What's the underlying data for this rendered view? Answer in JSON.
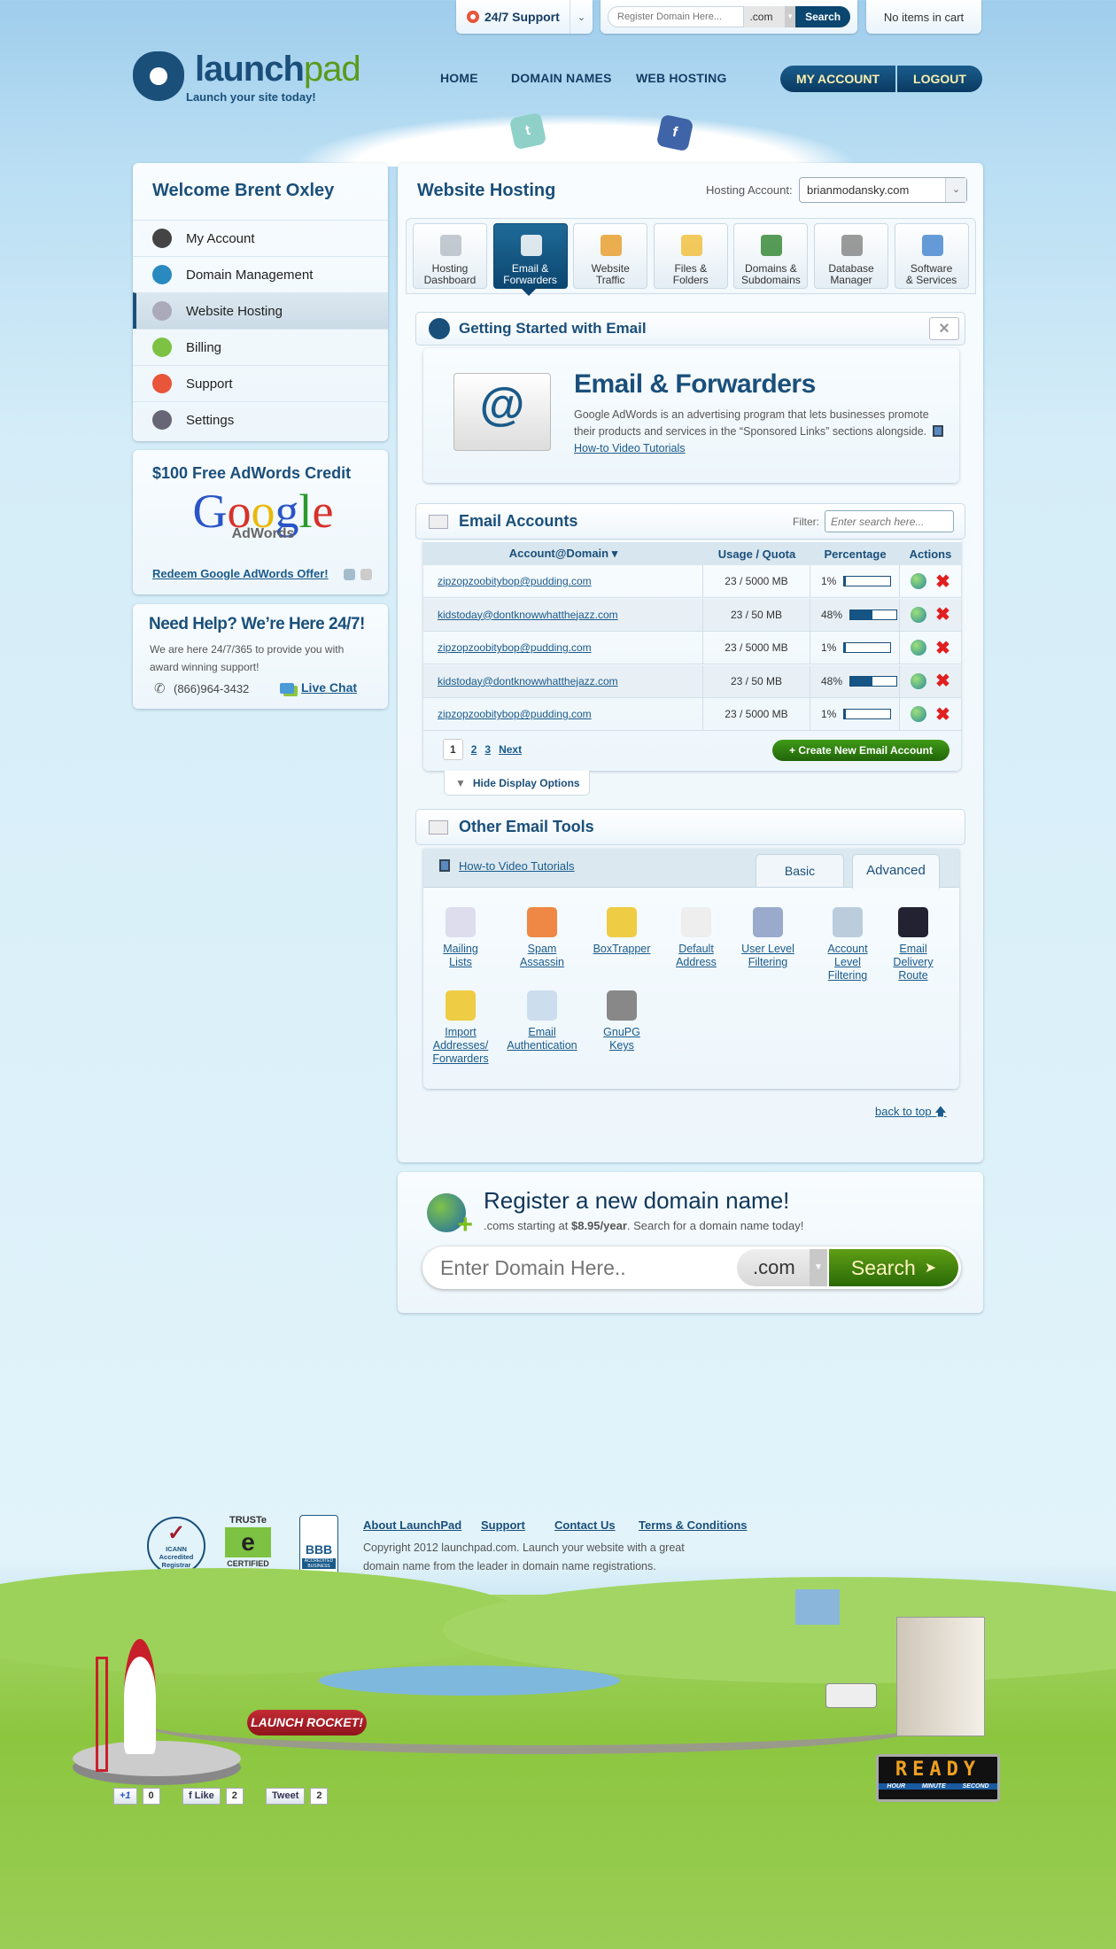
{
  "topbar": {
    "support_label": "24/7 Support",
    "domain_placeholder": "Register Domain Here...",
    "tld": ".com",
    "search_label": "Search",
    "cart_text": "No items in cart"
  },
  "brand": {
    "name_part1": "launch",
    "name_part2": "pad",
    "tagline": "Launch your site today!"
  },
  "nav": {
    "items": [
      "HOME",
      "DOMAIN NAMES",
      "WEB HOSTING"
    ],
    "my_account": "MY ACCOUNT",
    "logout": "LOGOUT"
  },
  "sidebar": {
    "welcome": "Welcome Brent Oxley",
    "items": [
      {
        "label": "My Account",
        "icon": "camera-icon"
      },
      {
        "label": "Domain Management",
        "icon": "globe-icon"
      },
      {
        "label": "Website Hosting",
        "icon": "server-icon",
        "active": true
      },
      {
        "label": "Billing",
        "icon": "money-icon"
      },
      {
        "label": "Support",
        "icon": "lifebuoy-icon"
      },
      {
        "label": "Settings",
        "icon": "tools-icon"
      }
    ],
    "adwords": {
      "title": "$100 Free AdWords Credit",
      "logo_text": "Google",
      "logo_sub": "AdWords",
      "link": "Redeem Google AdWords Offer!"
    },
    "help": {
      "title": "Need Help? We’re Here 24/7!",
      "text": "We are here 24/7/365 to provide you with award winning support!",
      "phone": "(866)964-3432",
      "chat": "Live Chat"
    }
  },
  "main": {
    "title": "Website Hosting",
    "hosting_label": "Hosting Account:",
    "hosting_value": "brianmodansky.com",
    "tabs": [
      {
        "l1": "Hosting",
        "l2": "Dashboard"
      },
      {
        "l1": "Email &",
        "l2": "Forwarders",
        "active": true
      },
      {
        "l1": "Website",
        "l2": "Traffic"
      },
      {
        "l1": "Files &",
        "l2": "Folders"
      },
      {
        "l1": "Domains &",
        "l2": "Subdomains"
      },
      {
        "l1": "Database",
        "l2": "Manager"
      },
      {
        "l1": "Software",
        "l2": "& Services"
      }
    ],
    "getting_started": {
      "title": "Getting Started with Email",
      "heading": "Email & Forwarders",
      "text": "Google AdWords is an advertising program that lets businesses promote their products and services in the “Sponsored Links” sections alongside.",
      "link": "How-to Video Tutorials"
    },
    "email_accounts": {
      "title": "Email Accounts",
      "filter_label": "Filter:",
      "filter_placeholder": "Enter search here...",
      "columns": [
        "Account@Domain ▾",
        "Usage / Quota",
        "Percentage",
        "Actions"
      ],
      "rows": [
        {
          "account": "zipzopzoobitybop@pudding.com",
          "usage": "23 / 5000 MB",
          "percent": 1
        },
        {
          "account": "kidstoday@dontknowwhatthejazz.com",
          "usage": "23 / 50 MB",
          "percent": 48
        },
        {
          "account": "zipzopzoobitybop@pudding.com",
          "usage": "23 / 5000 MB",
          "percent": 1
        },
        {
          "account": "kidstoday@dontknowwhatthejazz.com",
          "usage": "23 / 50 MB",
          "percent": 48
        },
        {
          "account": "zipzopzoobitybop@pudding.com",
          "usage": "23 / 5000 MB",
          "percent": 1
        }
      ],
      "pages": [
        "1",
        "2",
        "3",
        "Next"
      ],
      "create_label": "+ Create New Email Account",
      "hide_label": "Hide Display Options"
    },
    "other_tools": {
      "title": "Other Email Tools",
      "link": "How-to Video Tutorials",
      "tab_basic": "Basic",
      "tab_advanced": "Advanced",
      "tools": [
        [
          "Mailing",
          "Lists"
        ],
        [
          "Spam",
          "Assassin"
        ],
        [
          "BoxTrapper"
        ],
        [
          "Default",
          "Address"
        ],
        [
          "User Level",
          "Filtering"
        ],
        [
          "Account",
          "Level",
          "Filtering"
        ],
        [
          "Email",
          "Delivery",
          "Route"
        ],
        [
          "Import",
          "Addresses/",
          "Forwarders"
        ],
        [
          "Email",
          "Authentication"
        ],
        [
          "GnuPG",
          "Keys"
        ]
      ]
    },
    "back_to_top": "back to top"
  },
  "register": {
    "title": "Register a new domain name!",
    "sub_pre": ".coms starting at ",
    "sub_price": "$8.95/year",
    "sub_post": ". Search for a domain name today!",
    "placeholder": "Enter Domain Here..",
    "tld": ".com",
    "search": "Search"
  },
  "footer": {
    "links": [
      "About LaunchPad",
      "Support",
      "Contact Us",
      "Terms & Conditions"
    ],
    "copyright": "Copyright 2012 launchpad.com. Launch your website with a great domain name from the leader in domain name registrations.",
    "badges": {
      "icann": "ICANN Accredited Registrar",
      "truste_top": "TRUSTe",
      "truste_bottom": "CERTIFIED",
      "bbb": "BBB",
      "bbb_sub": "ACCREDITED BUSINESS"
    }
  },
  "scene": {
    "launch_button": "LAUNCH ROCKET!",
    "countdown": "READY",
    "countdown_labels": [
      "HOUR",
      "MINUTE",
      "SECOND"
    ],
    "social": [
      {
        "label": "+1",
        "count": "0"
      },
      {
        "label": "f Like",
        "count": "2"
      },
      {
        "label": "Tweet",
        "count": "2"
      }
    ]
  },
  "colors": {
    "brand_blue": "#1a4f7a",
    "brand_green": "#5a9a1a",
    "accent_dark": "#0a3a62",
    "create_green": "#2f7a0c",
    "delete_red": "#e02020"
  }
}
